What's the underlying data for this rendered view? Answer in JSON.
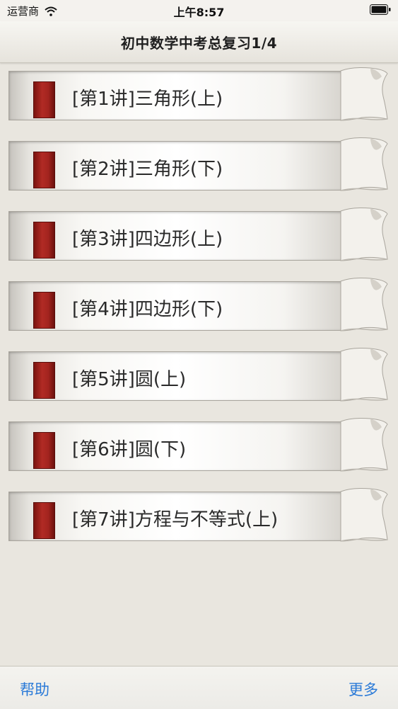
{
  "status_bar": {
    "carrier": "运营商",
    "time": "上午8:57"
  },
  "nav": {
    "title": "初中数学中考总复习1/4"
  },
  "lessons": [
    {
      "label": "[第1讲]三角形(上)"
    },
    {
      "label": "[第2讲]三角形(下)"
    },
    {
      "label": "[第3讲]四边形(上)"
    },
    {
      "label": "[第4讲]四边形(下)"
    },
    {
      "label": "[第5讲]圆(上)"
    },
    {
      "label": "[第6讲]圆(下)"
    },
    {
      "label": "[第7讲]方程与不等式(上)"
    }
  ],
  "toolbar": {
    "help_label": "帮助",
    "more_label": "更多"
  },
  "colors": {
    "marker": "#a3241f",
    "link": "#2a7ad8",
    "background": "#e9e6df"
  },
  "icons": {
    "wifi": "wifi-icon",
    "battery": "battery-icon",
    "marker": "bookmark-ribbon-icon",
    "curl": "page-curl-icon"
  }
}
